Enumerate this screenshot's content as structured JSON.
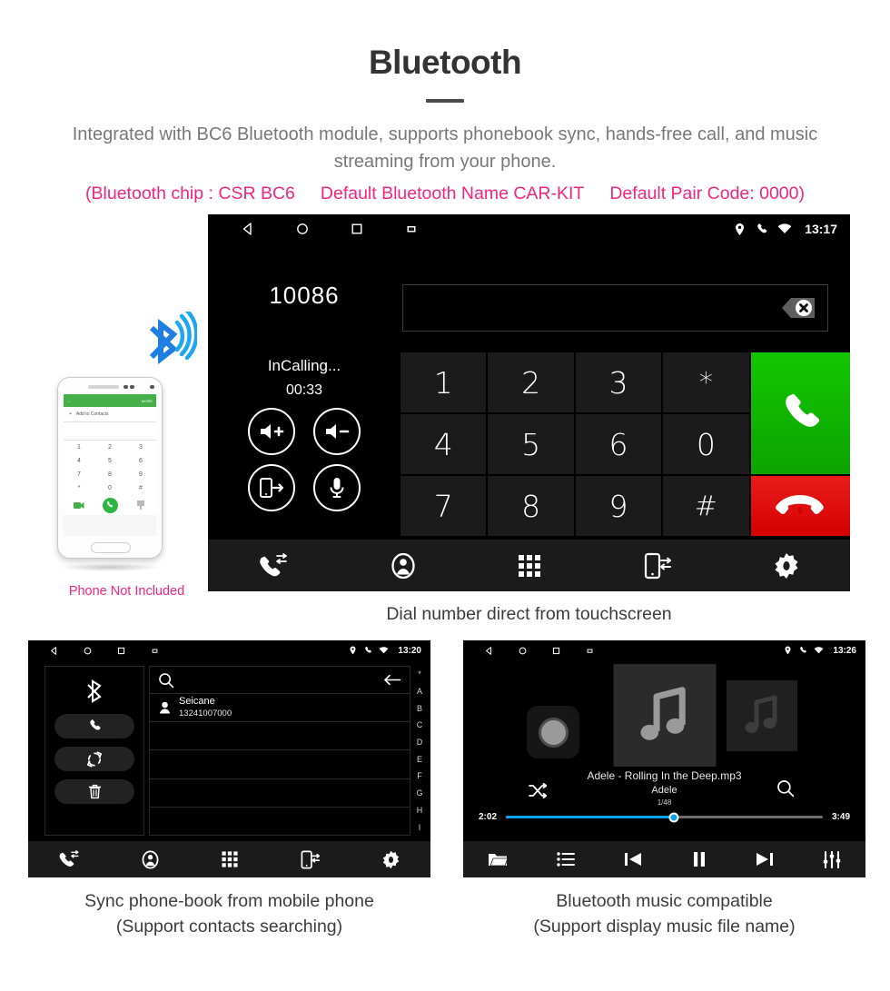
{
  "header": {
    "title": "Bluetooth",
    "subtitle": "Integrated with BC6 Bluetooth module, supports phonebook sync, hands-free call, and music streaming from your phone.",
    "note_open": "(Bluetooth chip : CSR BC6",
    "note_mid": "Default Bluetooth Name CAR-KIT",
    "note_close": "Default Pair Code: 0000)",
    "pink_color": "#f4257f",
    "title_color": "#333333"
  },
  "phone_mockup": {
    "note": "Phone Not Included",
    "topbar_back": "←",
    "topbar_more": "MORE",
    "add_contacts": "Add to Contacts",
    "add_plus": "+",
    "keys": [
      "1",
      "2",
      "3",
      "4",
      "5",
      "6",
      "7",
      "8",
      "9",
      "*",
      "0",
      "#"
    ],
    "accent_color": "#45b04a"
  },
  "dialer": {
    "caption": "Dial number direct from touchscreen",
    "statusbar": {
      "back_icon": "back-triangle-icon",
      "home_icon": "home-circle-icon",
      "recents_icon": "recents-square-icon",
      "screenshot_icon": "screenshot-icon",
      "location_icon": "location-pin-icon",
      "call_icon": "phone-handset-icon",
      "wifi_icon": "wifi-icon",
      "time": "13:17"
    },
    "number": "10086",
    "call_state": "InCalling...",
    "call_timer": "00:33",
    "controls": [
      {
        "name": "volume-up-button",
        "icon": "speaker-plus-icon"
      },
      {
        "name": "volume-down-button",
        "icon": "speaker-minus-icon"
      },
      {
        "name": "transfer-to-phone-button",
        "icon": "phone-transfer-icon"
      },
      {
        "name": "mute-microphone-button",
        "icon": "microphone-icon"
      }
    ],
    "input_value": "",
    "backspace_icon": "backspace-delete-icon",
    "keys": [
      "1",
      "2",
      "3",
      "*",
      "4",
      "5",
      "6",
      "0",
      "7",
      "8",
      "9",
      "#"
    ],
    "call_button": {
      "name": "answer-call-button",
      "color": "#12c700"
    },
    "end_button": {
      "name": "end-call-button",
      "color": "#ec1c1c"
    },
    "navbar": [
      {
        "name": "nav-call-history",
        "icon": "call-history-icon"
      },
      {
        "name": "nav-contacts",
        "icon": "contact-person-icon"
      },
      {
        "name": "nav-keypad",
        "icon": "keypad-grid-icon"
      },
      {
        "name": "nav-phone-sync",
        "icon": "phone-sync-icon"
      },
      {
        "name": "nav-settings",
        "icon": "gear-icon"
      }
    ]
  },
  "phonebook": {
    "caption_line1": "Sync phone-book from mobile phone",
    "caption_line2": "(Support contacts searching)",
    "statusbar": {
      "time": "13:20"
    },
    "side_buttons": [
      {
        "name": "bluetooth-status-icon",
        "icon": "bluetooth-icon"
      },
      {
        "name": "call-button",
        "icon": "phone-handset-icon"
      },
      {
        "name": "sync-contacts-button",
        "icon": "refresh-sync-icon"
      },
      {
        "name": "delete-contacts-button",
        "icon": "trash-icon"
      }
    ],
    "search_placeholder": "",
    "search_icon": "search-icon",
    "back_icon": "arrow-left-icon",
    "contacts": [
      {
        "name": "Seicane",
        "number": "13241007000"
      }
    ],
    "empty_rows": 4,
    "alpha_index": [
      "*",
      "A",
      "B",
      "C",
      "D",
      "E",
      "F",
      "G",
      "H",
      "I"
    ],
    "navbar": [
      {
        "name": "nav-call-history",
        "icon": "call-history-icon"
      },
      {
        "name": "nav-contacts",
        "icon": "contact-person-icon"
      },
      {
        "name": "nav-keypad",
        "icon": "keypad-grid-icon"
      },
      {
        "name": "nav-phone-sync",
        "icon": "phone-sync-icon"
      },
      {
        "name": "nav-settings",
        "icon": "gear-icon"
      }
    ]
  },
  "music": {
    "caption_line1": "Bluetooth music compatible",
    "caption_line2": "(Support display music file name)",
    "statusbar": {
      "time": "13:26"
    },
    "track_title": "Adele - Rolling In the Deep.mp3",
    "artist": "Adele",
    "track_count": "1/48",
    "elapsed": "2:02",
    "duration": "3:49",
    "progress_percent": 53,
    "accent_color": "#0aa3f0",
    "shuffle_icon": "shuffle-icon",
    "search_icon": "search-icon",
    "navbar": [
      {
        "name": "nav-folder",
        "icon": "folder-icon"
      },
      {
        "name": "nav-playlist",
        "icon": "list-icon"
      },
      {
        "name": "nav-previous",
        "icon": "previous-track-icon"
      },
      {
        "name": "nav-play-pause",
        "icon": "pause-icon"
      },
      {
        "name": "nav-next",
        "icon": "next-track-icon"
      },
      {
        "name": "nav-equalizer",
        "icon": "equalizer-icon"
      }
    ]
  }
}
